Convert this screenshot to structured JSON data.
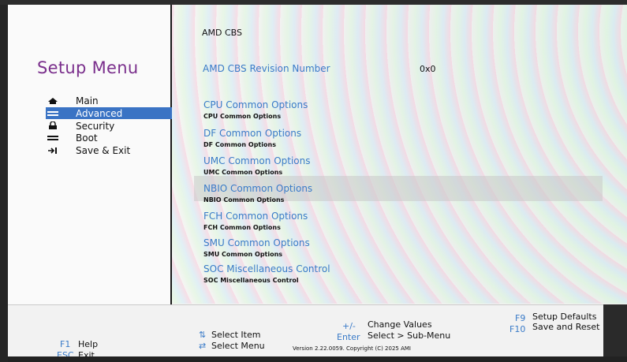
{
  "left": {
    "title": "Setup Menu",
    "nav": [
      {
        "label": "Main",
        "icon": "home-icon"
      },
      {
        "label": "Advanced",
        "icon": "advanced-icon",
        "selected": true
      },
      {
        "label": "Security",
        "icon": "lock-icon"
      },
      {
        "label": "Boot",
        "icon": "boot-icon"
      },
      {
        "label": "Save & Exit",
        "icon": "exit-icon"
      }
    ]
  },
  "content": {
    "header": "AMD CBS",
    "revision": {
      "label": "AMD CBS Revision Number",
      "value": "0x0"
    },
    "options": [
      {
        "title": "CPU Common Options",
        "sub": "CPU Common Options"
      },
      {
        "title": "DF Common Options",
        "sub": "DF Common Options"
      },
      {
        "title": "UMC Common Options",
        "sub": "UMC Common Options"
      },
      {
        "title": "NBIO Common Options",
        "sub": "NBIO Common Options"
      },
      {
        "title": "FCH Common Options",
        "sub": "FCH Common Options"
      },
      {
        "title": "SMU Common Options",
        "sub": "SMU Common Options"
      },
      {
        "title": "SOC Miscellaneous Control",
        "sub": "SOC Miscellaneous Control"
      }
    ]
  },
  "footer": {
    "f1_key": "F1",
    "f1_desc": "Help",
    "esc_key": "ESC",
    "esc_desc": "Exit",
    "updown_key": "⇅",
    "updown_desc": "Select Item",
    "leftright_key": "⇄",
    "leftright_desc": "Select Menu",
    "plusminus_key": "+/-",
    "plusminus_desc": "Change Values",
    "enter_key": "Enter",
    "enter_desc": "Select > Sub-Menu",
    "f9_key": "F9",
    "f9_desc": "Setup Defaults",
    "f10_key": "F10",
    "f10_desc": "Save and Reset",
    "version": "Version 2.22.0059. Copyright (C) 2025 AMI"
  },
  "colors": {
    "accent": "#3a73c4",
    "title": "#7a2f8c",
    "link": "#3a7bc8"
  }
}
